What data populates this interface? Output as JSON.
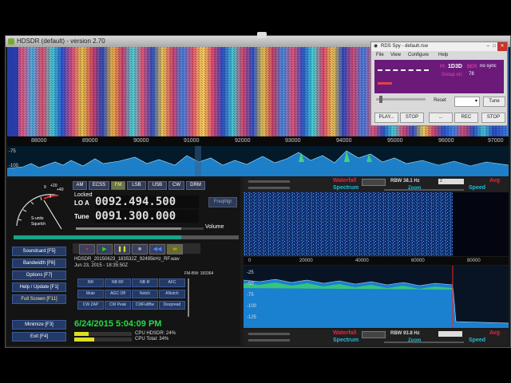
{
  "main_window": {
    "title": "HDSDR (default) - version 2.70"
  },
  "waterfall_axis": {
    "ticks": [
      "88000",
      "89000",
      "90000",
      "91000",
      "92000",
      "93000",
      "94000",
      "95000",
      "96000",
      "97000"
    ]
  },
  "spectrum": {
    "db_labels": [
      "-75",
      "-100"
    ]
  },
  "mode_buttons": [
    "AM",
    "ECSS",
    "FM",
    "LSB",
    "USB",
    "CW",
    "DRM"
  ],
  "active_mode": "FM",
  "smeter": {
    "label_line1": "S-units",
    "label_line2": "Squelch",
    "scale": [
      "9",
      "+20",
      "+40"
    ]
  },
  "frequency": {
    "locked_label": "Locked",
    "lo_label": "LO A",
    "lo_value": "0092.494.500",
    "tune_label": "Tune",
    "tune_value": "0091.300.000",
    "freqmgr_label": "FreqMgr",
    "volume_label": "Volume"
  },
  "side_buttons": [
    {
      "label": "Soundcard [F5]"
    },
    {
      "label": "Bandwidth [F6]"
    },
    {
      "label": "Options [F7]"
    },
    {
      "label": "Help / Update [F1]"
    },
    {
      "label": "Full Screen [F11]"
    },
    {
      "label": "Minimize [F3]"
    },
    {
      "label": "Exit [F4]"
    }
  ],
  "recording": {
    "filename": "HDSDR_20150623_183532Z_92495kHz_RF.wav",
    "date": "Jun 23, 2015 - 18:35:50Z",
    "fm_bw": "FM-BW: 183364"
  },
  "function_buttons": [
    "NR",
    "NB RF",
    "NB IF",
    "AFC",
    "Mute",
    "AGC Off",
    "Notch",
    "ANotch",
    "CW ZAP",
    "CW Peak",
    "CWFullBw",
    "Despread"
  ],
  "clock": "6/24/2015 5:04:09 PM",
  "cpu": {
    "hdsdr": "CPU HDSDR: 24%",
    "total": "CPU Total: 34%"
  },
  "rf_panel": {
    "waterfall": "Waterfall",
    "spectrum": "Spectrum",
    "rbw": "RBW 38.1 Hz",
    "zoom": "Zoom",
    "avg": "Avg",
    "speed": "Speed",
    "avg_value": "2"
  },
  "af_panel": {
    "waterfall": "Waterfall",
    "spectrum": "Spectrum",
    "rbw": "RBW 93.8 Hz",
    "zoom": "Zoom",
    "avg": "Avg",
    "speed": "Speed",
    "ticks": [
      "0",
      "20000",
      "40000",
      "60000",
      "80000"
    ],
    "db_labels": [
      "-25",
      "-50",
      "-75",
      "-100",
      "-125"
    ]
  },
  "rds_spy": {
    "title": "RDS Spy - default.rsw",
    "menu": [
      "File",
      "View",
      "Configure",
      "Help"
    ],
    "pi": "PI:",
    "pi_code": "1D3D",
    "ber": "BER",
    "sync": "no sync",
    "group_label": "Group on:",
    "group_value": "78",
    "buttons": [
      "Reset",
      "Tune",
      "PLAY...",
      "STOP",
      "...",
      "REC",
      "STOP"
    ]
  },
  "colors": {
    "waterfall_accent": "#e02244",
    "spectrum_accent": "#22bbdd",
    "digit_color": "#dddddd",
    "clock_color": "#22dd44",
    "rds_bg": "#6b1a7a"
  }
}
